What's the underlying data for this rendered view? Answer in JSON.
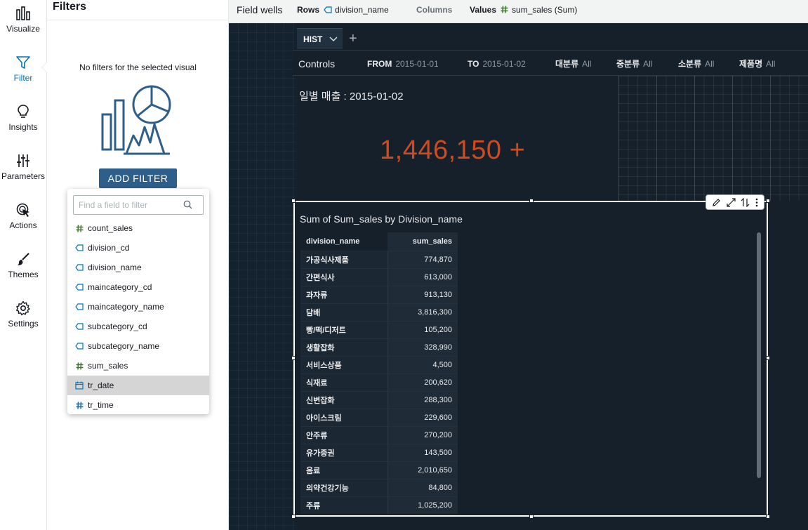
{
  "rail": {
    "items": [
      {
        "label": "Visualize",
        "icon": "visualize-icon"
      },
      {
        "label": "Filter",
        "icon": "filter-icon",
        "active": true
      },
      {
        "label": "Insights",
        "icon": "lightbulb-icon"
      },
      {
        "label": "Parameters",
        "icon": "sliders-icon"
      },
      {
        "label": "Actions",
        "icon": "cursor-click-icon"
      },
      {
        "label": "Themes",
        "icon": "brush-icon"
      },
      {
        "label": "Settings",
        "icon": "gear-icon"
      }
    ]
  },
  "filters": {
    "title": "Filters",
    "empty_message": "No filters for the selected visual",
    "add_button": "ADD FILTER",
    "search_placeholder": "Find a field to filter",
    "fields": [
      {
        "name": "count_sales",
        "type": "measure"
      },
      {
        "name": "division_cd",
        "type": "dimension"
      },
      {
        "name": "division_name",
        "type": "dimension"
      },
      {
        "name": "maincategory_cd",
        "type": "dimension"
      },
      {
        "name": "maincategory_name",
        "type": "dimension"
      },
      {
        "name": "subcategory_cd",
        "type": "dimension"
      },
      {
        "name": "subcategory_name",
        "type": "dimension"
      },
      {
        "name": "sum_sales",
        "type": "measure"
      },
      {
        "name": "tr_date",
        "type": "date",
        "highlighted": true
      },
      {
        "name": "tr_time",
        "type": "numeric"
      }
    ]
  },
  "fieldwells": {
    "title": "Field wells",
    "rows_label": "Rows",
    "rows_value": "division_name",
    "columns_label": "Columns",
    "values_label": "Values",
    "values_value": "sum_sales (Sum)"
  },
  "sheet": {
    "tab_name": "HIST",
    "add_tab": "+"
  },
  "controls": {
    "title": "Controls",
    "items": [
      {
        "label": "FROM",
        "value": "2015-01-01"
      },
      {
        "label": "TO",
        "value": "2015-01-02"
      },
      {
        "label": "대분류",
        "value": "All"
      },
      {
        "label": "중분류",
        "value": "All"
      },
      {
        "label": "소분류",
        "value": "All"
      },
      {
        "label": "제품명",
        "value": "All"
      }
    ]
  },
  "kpi": {
    "title": "일별 매출 : 2015-01-02",
    "value": "1,446,150",
    "trend_symbol": "+",
    "color": "#d04a1d"
  },
  "table_visual": {
    "title": "Sum of Sum_sales by Division_name",
    "columns": [
      "division_name",
      "sum_sales"
    ],
    "rows": [
      [
        "가공식사제품",
        "774,870"
      ],
      [
        "간편식사",
        "613,000"
      ],
      [
        "과자류",
        "913,130"
      ],
      [
        "담배",
        "3,816,300"
      ],
      [
        "빵/떡/디저트",
        "105,200"
      ],
      [
        "생활잡화",
        "328,990"
      ],
      [
        "서비스상품",
        "4,500"
      ],
      [
        "식재료",
        "200,620"
      ],
      [
        "신변잡화",
        "288,300"
      ],
      [
        "아이스크림",
        "229,600"
      ],
      [
        "안주류",
        "270,200"
      ],
      [
        "유가증권",
        "143,500"
      ],
      [
        "음료",
        "2,010,650"
      ],
      [
        "의약건강기능",
        "84,800"
      ],
      [
        "주류",
        "1,025,200"
      ]
    ]
  },
  "colors": {
    "accent": "#0073bb",
    "button": "#2e5f8a",
    "canvas": "#142230",
    "kpi": "#d04a1d"
  }
}
